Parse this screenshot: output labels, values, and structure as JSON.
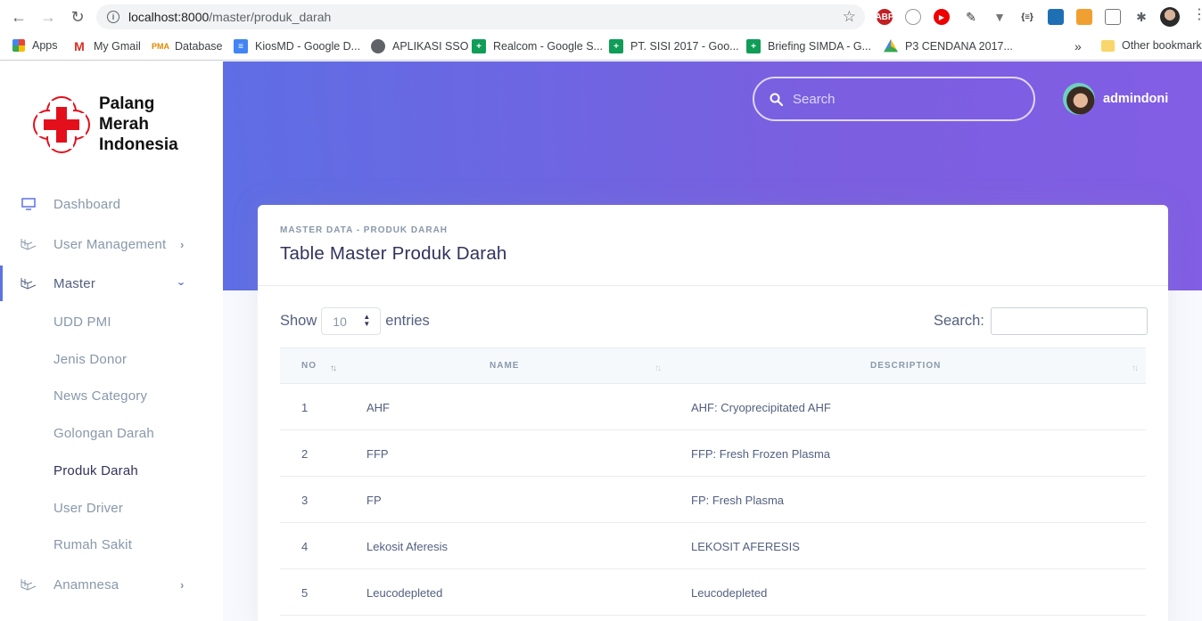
{
  "browser": {
    "url_host": "localhost:8000",
    "url_path": "/master/produk_darah",
    "bookmarks": [
      {
        "label": "Apps",
        "icon": "apps-grid-icon"
      },
      {
        "label": "My Gmail",
        "icon": "gmail-icon"
      },
      {
        "label": "Database",
        "icon": "pma-icon"
      },
      {
        "label": "KiosMD - Google D...",
        "icon": "google-docs-icon"
      },
      {
        "label": "APLIKASI SSO",
        "icon": "globe-icon"
      },
      {
        "label": "Realcom - Google S...",
        "icon": "google-sheets-icon"
      },
      {
        "label": "PT. SISI 2017 - Goo...",
        "icon": "google-sheets-icon"
      },
      {
        "label": "Briefing SIMDA - G...",
        "icon": "google-sheets-icon"
      },
      {
        "label": "P3 CENDANA 2017...",
        "icon": "google-drive-icon"
      }
    ],
    "overflow_label": "»",
    "other_bookmarks": "Other bookmarks"
  },
  "logo": {
    "line1": "Palang",
    "line2": "Merah",
    "line3": "Indonesia"
  },
  "sidebar": {
    "items": [
      {
        "label": "Dashboard"
      },
      {
        "label": "User Management"
      },
      {
        "label": "Master"
      },
      {
        "label": "Anamnesa"
      }
    ],
    "master_sub": [
      "UDD PMI",
      "Jenis Donor",
      "News Category",
      "Golongan Darah",
      "Produk Darah",
      "User Driver",
      "Rumah Sakit"
    ]
  },
  "header": {
    "search_placeholder": "Search",
    "username": "admindoni"
  },
  "card": {
    "kicker": "MASTER DATA - PRODUK DARAH",
    "title": "Table Master Produk Darah",
    "show_label": "Show",
    "entries_value": "10",
    "entries_label": "entries",
    "search_label": "Search:"
  },
  "table": {
    "columns": [
      "NO",
      "NAME",
      "DESCRIPTION"
    ],
    "rows": [
      {
        "no": "1",
        "name": "AHF",
        "description": "AHF: Cryoprecipitated AHF"
      },
      {
        "no": "2",
        "name": "FFP",
        "description": "FFP: Fresh Frozen Plasma"
      },
      {
        "no": "3",
        "name": "FP",
        "description": "FP: Fresh Plasma"
      },
      {
        "no": "4",
        "name": "Lekosit Aferesis",
        "description": "LEKOSIT AFERESIS"
      },
      {
        "no": "5",
        "name": "Leucodepleted",
        "description": "Leucodepleted"
      }
    ]
  },
  "colors": {
    "accent": "#5e72e4",
    "header_gradient_end": "#825ee4",
    "pmi_red": "#e3101c"
  }
}
